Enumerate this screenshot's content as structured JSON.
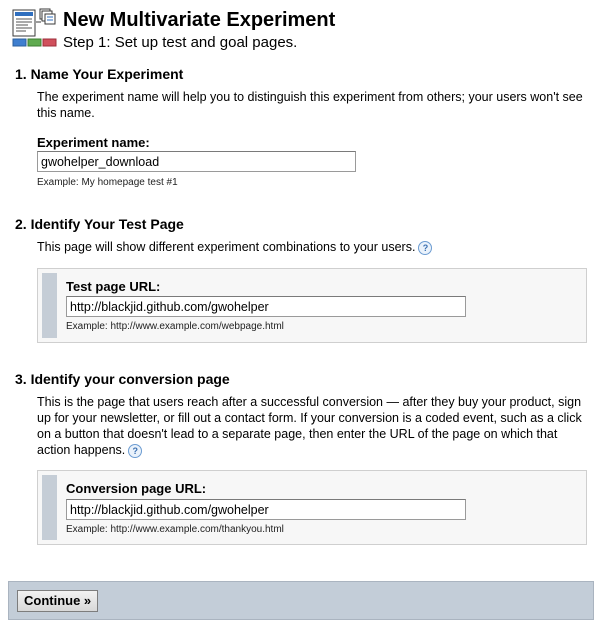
{
  "header": {
    "title": "New Multivariate Experiment",
    "subtitle": "Step 1: Set up test and goal pages.",
    "logo_icon": "experiment-logo-icon"
  },
  "section1": {
    "heading": "1. Name Your Experiment",
    "description": "The experiment name will help you to distinguish this experiment from others; your users won't see this name.",
    "field_label": "Experiment name:",
    "field_value": "gwohelper_download",
    "example": "Example: My homepage test #1"
  },
  "section2": {
    "heading": "2. Identify Your Test Page",
    "description": "This page will show different experiment combinations to your users.",
    "help_icon": "help-icon",
    "field_label": "Test page URL:",
    "field_value": "http://blackjid.github.com/gwohelper",
    "example": "Example: http://www.example.com/webpage.html"
  },
  "section3": {
    "heading": "3. Identify your conversion page",
    "description": "This is the page that users reach after a successful conversion — after they buy your product, sign up for your newsletter, or fill out a contact form. If your conversion is a coded event, such as a click on a button that doesn't lead to a separate page, then enter the URL of the page on which that action happens.",
    "help_icon": "help-icon",
    "field_label": "Conversion page URL:",
    "field_value": "http://blackjid.github.com/gwohelper",
    "example": "Example: http://www.example.com/thankyou.html"
  },
  "footer": {
    "continue_label": "Continue »"
  },
  "colors": {
    "footer_bg": "#c3cdd8",
    "url_box_bg": "#f7f7f7",
    "url_box_bar": "#c5cdd6",
    "help_icon": "#3a6fb0"
  }
}
